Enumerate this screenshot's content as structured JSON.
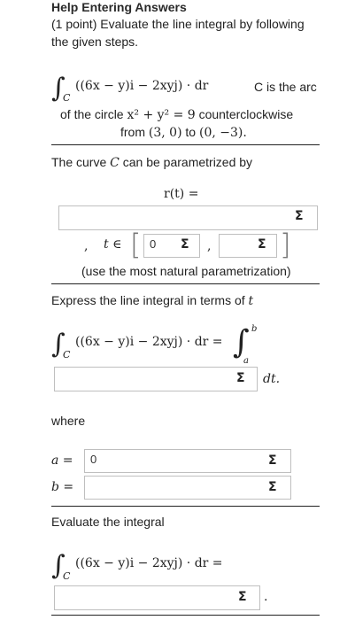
{
  "help_link": "Help Entering Answers",
  "problem": {
    "line1": "(1 point) Evaluate the line integral by following",
    "line2": "the given steps.",
    "integrand": "((6x − y)i − 2xyj) · dr",
    "c_is": "C is the arc",
    "circle_a": "of the circle ",
    "circle_eq": "x² + y² = 9",
    "circle_b": " counterclockwise",
    "from_a": "from ",
    "from_p1": "(3, 0)",
    "from_to": " to ",
    "from_p2": "(0, −3)."
  },
  "param": {
    "heading_a": "The curve ",
    "heading_c": "C",
    "heading_b": " can be parametrized by",
    "rt_label": "r(t) =",
    "comma": ",",
    "t_in": "t ∈",
    "lower_value": "0",
    "upper_value": "",
    "sep": ",",
    "note": "(use the most natural parametrization)"
  },
  "express": {
    "heading_a": "Express the line integral in terms of ",
    "heading_t": "t",
    "integrand": "((6x − y)i − 2xyj) · dr =",
    "upper_limit": "b",
    "lower_limit": "a",
    "dt": "dt.",
    "where": "where",
    "a_label": "a =",
    "a_value": "0",
    "b_label": "b =",
    "b_value": ""
  },
  "evaluate": {
    "heading": "Evaluate the integral",
    "integrand": "((6x − y)i − 2xyj) · dr =",
    "period": "."
  },
  "symbols": {
    "sigma": "Σ",
    "integral": "∫",
    "sub_c": "C"
  }
}
